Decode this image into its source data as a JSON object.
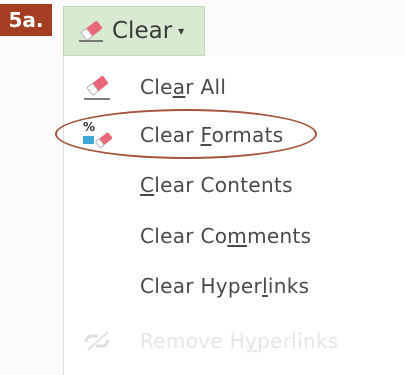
{
  "step_badge": "5a.",
  "clear_button": {
    "label": "Clear",
    "icon": "eraser-icon",
    "caret": "chevron-down-icon"
  },
  "menu": {
    "items": [
      {
        "pre": "Cle",
        "accel": "a",
        "post": "r All",
        "icon": "eraser-icon",
        "enabled": true
      },
      {
        "pre": "Clear ",
        "accel": "F",
        "post": "ormats",
        "icon": "clear-formats-icon",
        "enabled": true
      },
      {
        "pre": "",
        "accel": "C",
        "post": "lear Contents",
        "icon": "",
        "enabled": true
      },
      {
        "pre": "Clear Co",
        "accel": "m",
        "post": "ments",
        "icon": "",
        "enabled": true
      },
      {
        "pre": "Clear Hyper",
        "accel": "l",
        "post": "inks",
        "icon": "",
        "enabled": true
      },
      {
        "pre": "Remove H",
        "accel": "y",
        "post": "perlinks",
        "icon": "remove-hyperlink-icon",
        "enabled": false
      }
    ]
  },
  "colors": {
    "badge": "#a43d21",
    "button_bg": "#d8ead2",
    "highlight": "#a4553c",
    "eraser_pink": "#e8687a"
  }
}
